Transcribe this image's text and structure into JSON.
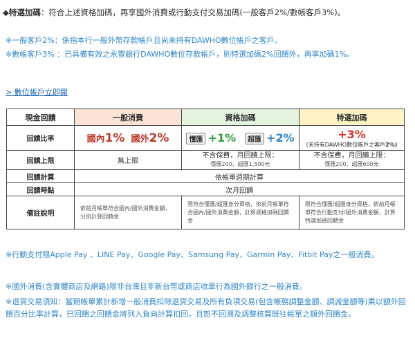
{
  "intro": {
    "diamond": "◆",
    "lead": "特選加碼",
    "text": "：符合上述資格加碼，再享國外消費或行動支付交易加碼(一般客戶2%/數帳客戶3%)。"
  },
  "notes": [
    "※一般客戶2%：係指本行一般外幣存款帳戶且尚未持有DAWHO數位帳戶之客戶。",
    "※數帳客戶3% ：已具備有效之永豐銀行DAWHO數位存款帳戶，則特選加碼2%回饋外，再享加碼1%。"
  ],
  "link": "> 數位帳戶立即開",
  "table": {
    "headers": [
      "現金回饋",
      "一般消費",
      "資格加碼",
      "特選加碼"
    ],
    "rate_label": "回饋比率",
    "rate_general": {
      "a": "國內",
      "a_pct": "1%",
      "b": "國外",
      "b_pct": "2%"
    },
    "rate_qual": {
      "badge1": "懂匯",
      "p1": "+1%",
      "badge2": "超匯",
      "p2": "+2%"
    },
    "rate_spec": {
      "p": "+3%",
      "note1": "(未持有DAWHO數位帳戶之客戶",
      "note2": "2%)"
    },
    "cap_label": "回饋上限",
    "cap_general": "無上限",
    "cap_qual": {
      "line": "不含保費，月回饋上限：",
      "sub": "懂匯200、超匯1,500元"
    },
    "cap_spec": {
      "line": "不含保費，月回饋上限：",
      "sub": "懂匯200、超匯600元"
    },
    "calc_label": "回饋計算",
    "calc_value": "依帳單週期計算",
    "time_label": "回饋時點",
    "time_value": "次月回饋",
    "remark_label": "備註說明",
    "remark_general": "依前月帳單符合國內/國外消費金額，分別計算回饋金",
    "remark_qual": "限符合懂匯/超匯身分資格，依前月帳單符合國內/國外消費金額，計算資格加碼回饋金",
    "remark_spec": "限符合懂匯/超匯身分資格，依前月帳單符合行動支付/國外消費金額，計算特選加碼回饋金"
  },
  "footnotes": [
    "※行動支付限Apple Pay 、LINE Pay、Google Pay、Samsung Pay、Garmin Pay、Fitbit Pay之一般消費。",
    "※國外消費(含實體商店及網路)限非台灣且非新台幣或商店收單行為國外銀行之一般消費。",
    "※退貨交易須知：當期帳單累計新增一般消費扣除退貨交易及所有負項交易(包含帳務調整金額、調減金額等)乘以額外回饋百分比率計算，已回饋之回饋金將列入負向計算扣回，且恕不回溯及調整核算既往帳單之額外回饋金。"
  ],
  "colors": {
    "general_bg": "#fce3d8",
    "qual_bg": "#e3f3dd",
    "spec_bg": "#fdf3c7",
    "note_blue": "#2f86c9"
  }
}
